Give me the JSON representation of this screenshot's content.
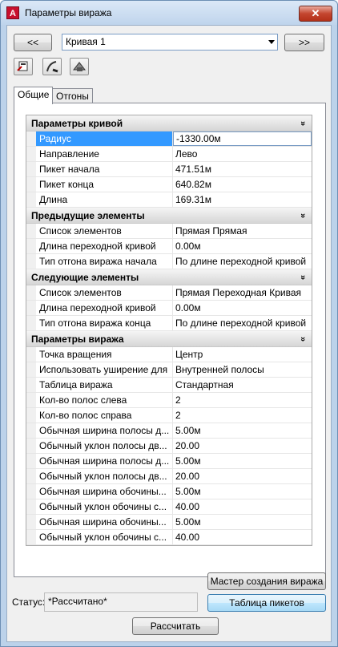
{
  "window": {
    "title": "Параметры виража",
    "app_icon_glyph": "A",
    "close_glyph": "✕"
  },
  "nav": {
    "prev_label": "<<",
    "next_label": ">>",
    "curve_select": "Кривая 1"
  },
  "tabs": [
    "Общие",
    "Отгоны"
  ],
  "categories": [
    {
      "title": "Параметры кривой",
      "rows": [
        {
          "name": "Радиус",
          "value": "-1330.00м"
        },
        {
          "name": "Направление",
          "value": "Лево"
        },
        {
          "name": "Пикет начала",
          "value": "471.51м"
        },
        {
          "name": "Пикет конца",
          "value": "640.82м"
        },
        {
          "name": "Длина",
          "value": "169.31м"
        }
      ]
    },
    {
      "title": "Предыдущие элементы",
      "rows": [
        {
          "name": "Список элементов",
          "value": "Прямая  Прямая"
        },
        {
          "name": "Длина переходной кривой",
          "value": "0.00м"
        },
        {
          "name": "Тип отгона виража начала",
          "value": "По длине переходной кривой"
        }
      ]
    },
    {
      "title": "Следующие элементы",
      "rows": [
        {
          "name": "Список элементов",
          "value": "Прямая  Переходная Кривая"
        },
        {
          "name": "Длина переходной кривой",
          "value": "0.00м"
        },
        {
          "name": "Тип отгона виража конца",
          "value": "По длине переходной кривой"
        }
      ]
    },
    {
      "title": "Параметры виража",
      "rows": [
        {
          "name": "Точка вращения",
          "value": "Центр"
        },
        {
          "name": "Использовать уширение для",
          "value": "Внутренней полосы"
        },
        {
          "name": "Таблица виража",
          "value": "Стандартная"
        },
        {
          "name": "Кол-во полос слева",
          "value": "2"
        },
        {
          "name": "Кол-во полос справа",
          "value": "2"
        },
        {
          "name": "Обычная ширина полосы д...",
          "value": "5.00м"
        },
        {
          "name": "Обычный уклон полосы дв...",
          "value": "20.00"
        },
        {
          "name": "Обычная ширина полосы д...",
          "value": "5.00м"
        },
        {
          "name": "Обычный уклон полосы дв...",
          "value": "20.00"
        },
        {
          "name": "Обычная ширина обочины...",
          "value": "5.00м"
        },
        {
          "name": "Обычный уклон обочины с...",
          "value": "40.00"
        },
        {
          "name": "Обычная ширина обочины...",
          "value": "5.00м"
        },
        {
          "name": "Обычный уклон обочины с...",
          "value": "40.00"
        }
      ]
    }
  ],
  "collapse_glyph": "»",
  "footer": {
    "wizard_button": "Мастер создания виража",
    "status_label": "Статус:",
    "status_value": "*Рассчитано*",
    "stations_button": "Таблица пикетов",
    "calculate_button": "Рассчитать"
  },
  "colors": {
    "selection": "#3399ff",
    "title_bar": "#bfd4ec",
    "close_button": "#c4452f"
  }
}
